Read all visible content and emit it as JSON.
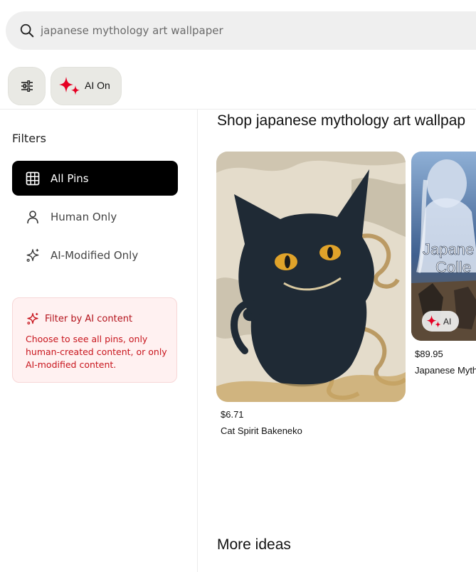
{
  "search": {
    "value": "japanese mythology art wallpaper",
    "placeholder": "Search"
  },
  "chips": {
    "ai_label": "AI On"
  },
  "filters": {
    "title": "Filters",
    "items": [
      {
        "label": "All Pins",
        "icon": "grid-icon",
        "active": true
      },
      {
        "label": "Human Only",
        "icon": "person-icon",
        "active": false
      },
      {
        "label": "AI-Modified Only",
        "icon": "sparkles-icon",
        "active": false
      }
    ],
    "info": {
      "title": "Filter by AI content",
      "body": "Choose to see all pins, only human-created content, or only AI-modified content."
    }
  },
  "shop": {
    "title": "Shop japanese mythology art wallpap",
    "products": [
      {
        "price": "$6.71",
        "name": "Cat Spirit Bakeneko",
        "ai": false
      },
      {
        "price": "$89.95",
        "name": "Japanese Myth",
        "ai": true,
        "ai_label": "AI",
        "image_text": [
          "Japane",
          "Colle"
        ]
      }
    ]
  },
  "more_ideas": "More ideas",
  "colors": {
    "ai_red": "#e60023",
    "active_bg": "#000000",
    "info_bg": "#fff1f1",
    "info_text": "#c8151d"
  }
}
